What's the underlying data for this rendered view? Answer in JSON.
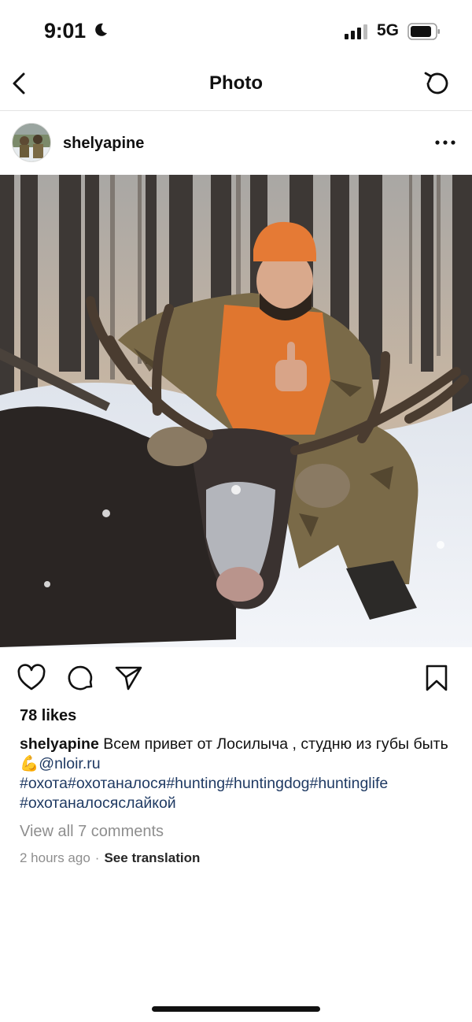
{
  "status_bar": {
    "time": "9:01",
    "network": "5G"
  },
  "nav": {
    "title": "Photo"
  },
  "post": {
    "username": "shelyapine",
    "likes": "78 likes",
    "caption": {
      "username": "shelyapine",
      "text": " Всем привет от Лосилыча , студню из губы быть ",
      "emoji": "💪",
      "mention": "@nloir.ru",
      "hashtags_line1": "#охота#охотаналося#hunting#huntingdog#huntinglife",
      "hashtags_line2": "#охотаналосяслайкой"
    },
    "view_comments": "View all 7 comments",
    "timestamp": "2 hours ago",
    "separator": "·",
    "see_translation": "See translation"
  },
  "icons": {
    "back": "chevron-left-icon",
    "refresh": "refresh-icon",
    "more": "more-horizontal-icon",
    "like": "heart-icon",
    "comment": "comment-icon",
    "share": "send-icon",
    "save": "bookmark-icon"
  }
}
